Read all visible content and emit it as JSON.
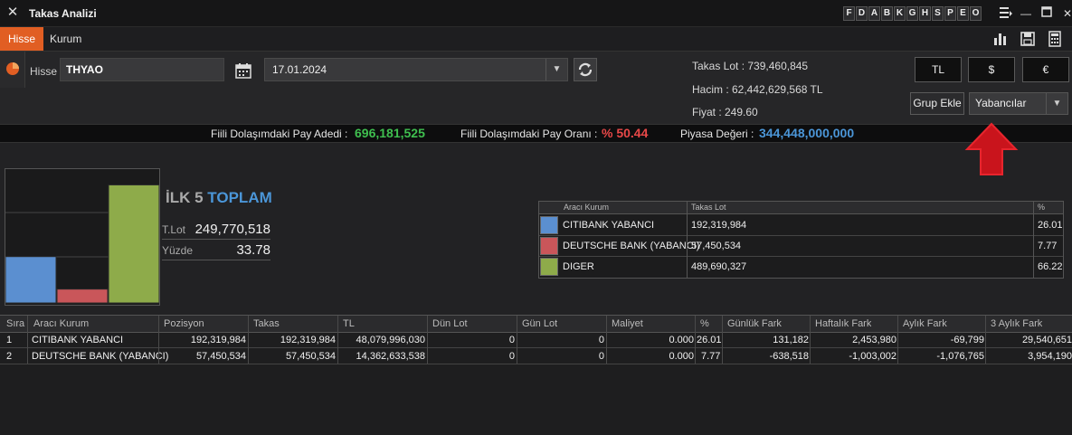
{
  "window": {
    "title": "Takas Analizi",
    "letters": [
      "F",
      "D",
      "A",
      "B",
      "K",
      "G",
      "H",
      "S",
      "P",
      "E",
      "O"
    ]
  },
  "tabs": [
    {
      "label": "Hisse",
      "active": true
    },
    {
      "label": "Kurum",
      "active": false
    }
  ],
  "toolbar_icons": [
    "bar-chart-icon",
    "save-icon",
    "calculator-icon"
  ],
  "search": {
    "hisse_label": "Hisse",
    "hisse_value": "THYAO",
    "date_value": "17.01.2024"
  },
  "info": {
    "takas_lot": "Takas Lot : 739,460,845",
    "hacim": "Hacim : 62,442,629,568 TL",
    "fiyat": "Fiyat : 249.60"
  },
  "currency_buttons": [
    "TL",
    "$",
    "€"
  ],
  "grup_ekle": "Grup Ekle",
  "group_select": "Yabancılar",
  "stats": {
    "fiili_adet_label": "Fiili Dolaşımdaki Pay Adedi :",
    "fiili_adet_value": "696,181,525",
    "fiili_oran_label": "Fiili Dolaşımdaki Pay Oranı :",
    "fiili_oran_value": "% 50.44",
    "piyasa_label": "Piyasa Değeri :",
    "piyasa_value": "344,448,000,000"
  },
  "summary": {
    "title_prefix": "İLK 5",
    "title_suffix": "TOPLAM",
    "tlot_label": "T.Lot",
    "tlot_value": "249,770,518",
    "yuzde_label": "Yüzde",
    "yuzde_value": "33.78"
  },
  "legend": {
    "headers": [
      "Aracı Kurum",
      "Takas Lot",
      "%"
    ],
    "rows": [
      {
        "name": "CITIBANK YABANCI",
        "lot": "192,319,984",
        "pct": "26.01",
        "color": "#5b8fd0"
      },
      {
        "name": "DEUTSCHE BANK (YABANCI)",
        "lot": "57,450,534",
        "pct": "7.77",
        "color": "#c9565a"
      },
      {
        "name": "DIGER",
        "lot": "489,690,327",
        "pct": "66.22",
        "color": "#8eab4a"
      }
    ]
  },
  "chart_data": {
    "type": "bar",
    "categories": [
      "CITIBANK YABANCI",
      "DEUTSCHE BANK (YABANCI)",
      "DIGER"
    ],
    "values": [
      26.01,
      7.77,
      66.22
    ],
    "colors": [
      "#5b8fd0",
      "#c9565a",
      "#8eab4a"
    ],
    "ylim": [
      0,
      70
    ],
    "grid": true
  },
  "table": {
    "headers": [
      "Sıra",
      "Aracı Kurum",
      "Pozisyon",
      "Takas",
      "TL",
      "Dün Lot",
      "Gün Lot",
      "Maliyet",
      "%",
      "Günlük Fark",
      "Haftalık Fark",
      "Aylık Fark",
      "3 Aylık Fark"
    ],
    "rows": [
      [
        "1",
        "CITIBANK YABANCI",
        "192,319,984",
        "192,319,984",
        "48,079,996,030",
        "0",
        "0",
        "0.000",
        "26.01",
        "131,182",
        "2,453,980",
        "-69,799",
        "29,540,651"
      ],
      [
        "2",
        "DEUTSCHE BANK (YABANCI)",
        "57,450,534",
        "57,450,534",
        "14,362,633,538",
        "0",
        "0",
        "0.000",
        "7.77",
        "-638,518",
        "-1,003,002",
        "-1,076,765",
        "3,954,190"
      ]
    ]
  }
}
